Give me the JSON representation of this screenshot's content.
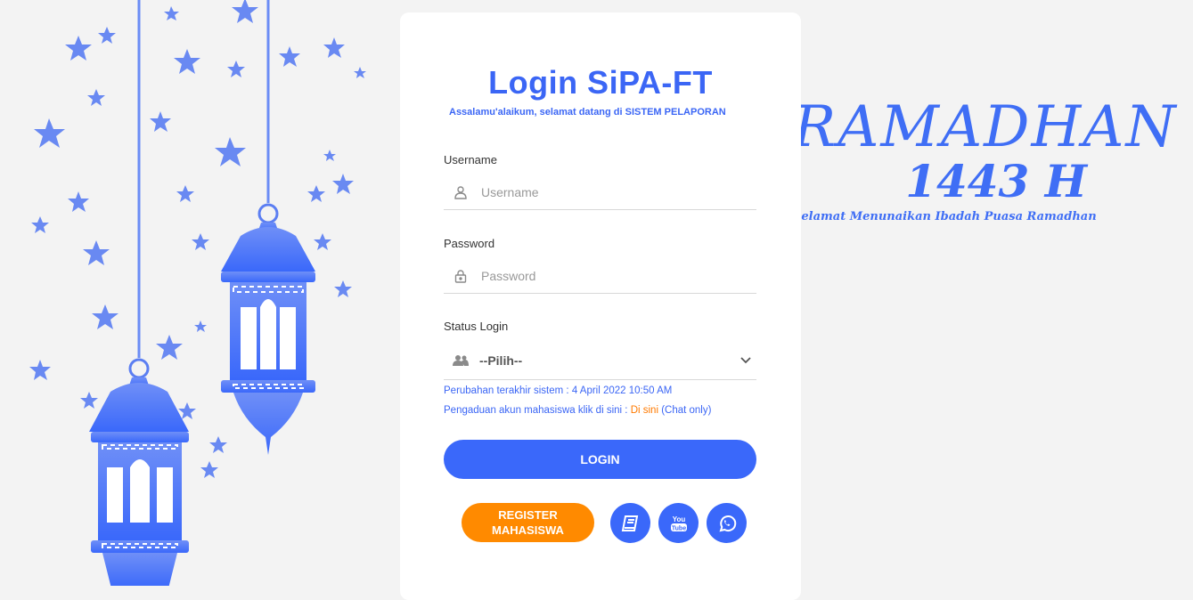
{
  "background": {
    "word": "RAMADHAN",
    "year": "1443 H",
    "greeting": "Selamat Menunaikan Ibadah Puasa Ramadhan"
  },
  "login": {
    "title": "Login SiPA-FT",
    "subtitle": "Assalamu'alaikum, selamat datang di SISTEM PELAPORAN",
    "username": {
      "label": "Username",
      "placeholder": "Username",
      "value": "",
      "icon": "user-icon"
    },
    "password": {
      "label": "Password",
      "placeholder": "Password",
      "value": "",
      "icon": "lock-icon"
    },
    "status": {
      "label": "Status Login",
      "selected": "--Pilih--",
      "icon": "users-icon"
    },
    "info_last_change": "Perubahan terakhir sistem : 4 April 2022 10:50 AM",
    "info_complaint_prefix": "Pengaduan akun mahasiswa klik di sini :",
    "info_complaint_link": "Di sini",
    "info_complaint_suffix": "(Chat only)",
    "login_button": "LOGIN",
    "register_button_line1": "REGISTER",
    "register_button_line2": "MAHASISWA",
    "icons": [
      "book-icon",
      "youtube-icon",
      "whatsapp-icon"
    ]
  },
  "colors": {
    "primary": "#3a68fa",
    "accent": "#ff8a00",
    "background": "#f3f3f3"
  }
}
